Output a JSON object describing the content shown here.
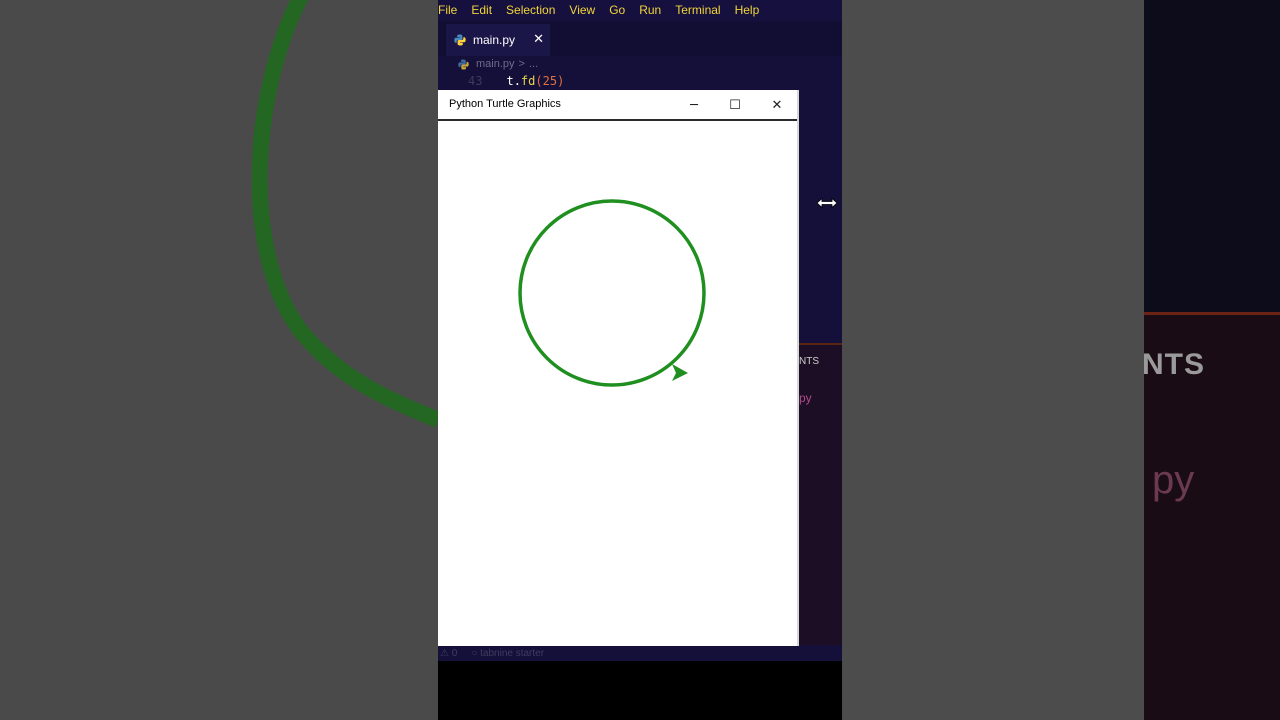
{
  "menubar": {
    "items": [
      "File",
      "Edit",
      "Selection",
      "View",
      "Go",
      "Run",
      "Terminal",
      "Help"
    ]
  },
  "editor": {
    "tab": {
      "label": "main.py",
      "close": "✕"
    },
    "breadcrumb": {
      "file": "main.py",
      "separator": ">",
      "rest": "..."
    },
    "code_line": {
      "number": "43",
      "object": "t",
      "dot": ".",
      "function": "fd",
      "open": "(",
      "arg": "25",
      "close": ")"
    }
  },
  "side_panel": {
    "section_label": "NTS",
    "file_label": "py"
  },
  "statusbar": {
    "problems": "⚠ 0",
    "extension": "○ tabnine starter"
  },
  "turtle_window": {
    "title": "Python Turtle Graphics",
    "minimize": "─",
    "maximize": "☐",
    "close": "✕",
    "pen_color": "#1f8f1f",
    "shape": "circle",
    "turtle_shape": "arrow"
  },
  "colors": {
    "menu_text": "#f2d43a",
    "editor_bg": "#14103a",
    "canvas_bg": "#ffffff"
  },
  "background_ghost": {
    "right_label": "NTS",
    "right_file": "py"
  }
}
